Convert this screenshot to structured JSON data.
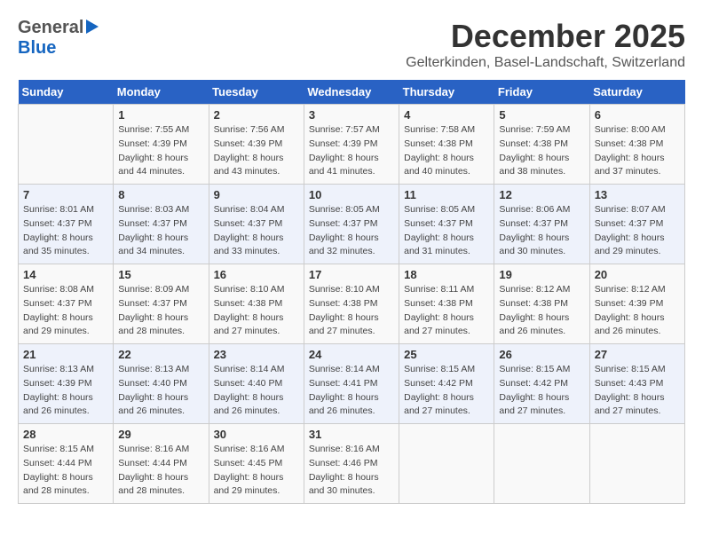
{
  "header": {
    "logo_general": "General",
    "logo_blue": "Blue",
    "month_title": "December 2025",
    "subtitle": "Gelterkinden, Basel-Landschaft, Switzerland"
  },
  "weekdays": [
    "Sunday",
    "Monday",
    "Tuesday",
    "Wednesday",
    "Thursday",
    "Friday",
    "Saturday"
  ],
  "weeks": [
    [
      {
        "day": "",
        "sunrise": "",
        "sunset": "",
        "daylight": ""
      },
      {
        "day": "1",
        "sunrise": "Sunrise: 7:55 AM",
        "sunset": "Sunset: 4:39 PM",
        "daylight": "Daylight: 8 hours and 44 minutes."
      },
      {
        "day": "2",
        "sunrise": "Sunrise: 7:56 AM",
        "sunset": "Sunset: 4:39 PM",
        "daylight": "Daylight: 8 hours and 43 minutes."
      },
      {
        "day": "3",
        "sunrise": "Sunrise: 7:57 AM",
        "sunset": "Sunset: 4:39 PM",
        "daylight": "Daylight: 8 hours and 41 minutes."
      },
      {
        "day": "4",
        "sunrise": "Sunrise: 7:58 AM",
        "sunset": "Sunset: 4:38 PM",
        "daylight": "Daylight: 8 hours and 40 minutes."
      },
      {
        "day": "5",
        "sunrise": "Sunrise: 7:59 AM",
        "sunset": "Sunset: 4:38 PM",
        "daylight": "Daylight: 8 hours and 38 minutes."
      },
      {
        "day": "6",
        "sunrise": "Sunrise: 8:00 AM",
        "sunset": "Sunset: 4:38 PM",
        "daylight": "Daylight: 8 hours and 37 minutes."
      }
    ],
    [
      {
        "day": "7",
        "sunrise": "Sunrise: 8:01 AM",
        "sunset": "Sunset: 4:37 PM",
        "daylight": "Daylight: 8 hours and 35 minutes."
      },
      {
        "day": "8",
        "sunrise": "Sunrise: 8:03 AM",
        "sunset": "Sunset: 4:37 PM",
        "daylight": "Daylight: 8 hours and 34 minutes."
      },
      {
        "day": "9",
        "sunrise": "Sunrise: 8:04 AM",
        "sunset": "Sunset: 4:37 PM",
        "daylight": "Daylight: 8 hours and 33 minutes."
      },
      {
        "day": "10",
        "sunrise": "Sunrise: 8:05 AM",
        "sunset": "Sunset: 4:37 PM",
        "daylight": "Daylight: 8 hours and 32 minutes."
      },
      {
        "day": "11",
        "sunrise": "Sunrise: 8:05 AM",
        "sunset": "Sunset: 4:37 PM",
        "daylight": "Daylight: 8 hours and 31 minutes."
      },
      {
        "day": "12",
        "sunrise": "Sunrise: 8:06 AM",
        "sunset": "Sunset: 4:37 PM",
        "daylight": "Daylight: 8 hours and 30 minutes."
      },
      {
        "day": "13",
        "sunrise": "Sunrise: 8:07 AM",
        "sunset": "Sunset: 4:37 PM",
        "daylight": "Daylight: 8 hours and 29 minutes."
      }
    ],
    [
      {
        "day": "14",
        "sunrise": "Sunrise: 8:08 AM",
        "sunset": "Sunset: 4:37 PM",
        "daylight": "Daylight: 8 hours and 29 minutes."
      },
      {
        "day": "15",
        "sunrise": "Sunrise: 8:09 AM",
        "sunset": "Sunset: 4:37 PM",
        "daylight": "Daylight: 8 hours and 28 minutes."
      },
      {
        "day": "16",
        "sunrise": "Sunrise: 8:10 AM",
        "sunset": "Sunset: 4:38 PM",
        "daylight": "Daylight: 8 hours and 27 minutes."
      },
      {
        "day": "17",
        "sunrise": "Sunrise: 8:10 AM",
        "sunset": "Sunset: 4:38 PM",
        "daylight": "Daylight: 8 hours and 27 minutes."
      },
      {
        "day": "18",
        "sunrise": "Sunrise: 8:11 AM",
        "sunset": "Sunset: 4:38 PM",
        "daylight": "Daylight: 8 hours and 27 minutes."
      },
      {
        "day": "19",
        "sunrise": "Sunrise: 8:12 AM",
        "sunset": "Sunset: 4:38 PM",
        "daylight": "Daylight: 8 hours and 26 minutes."
      },
      {
        "day": "20",
        "sunrise": "Sunrise: 8:12 AM",
        "sunset": "Sunset: 4:39 PM",
        "daylight": "Daylight: 8 hours and 26 minutes."
      }
    ],
    [
      {
        "day": "21",
        "sunrise": "Sunrise: 8:13 AM",
        "sunset": "Sunset: 4:39 PM",
        "daylight": "Daylight: 8 hours and 26 minutes."
      },
      {
        "day": "22",
        "sunrise": "Sunrise: 8:13 AM",
        "sunset": "Sunset: 4:40 PM",
        "daylight": "Daylight: 8 hours and 26 minutes."
      },
      {
        "day": "23",
        "sunrise": "Sunrise: 8:14 AM",
        "sunset": "Sunset: 4:40 PM",
        "daylight": "Daylight: 8 hours and 26 minutes."
      },
      {
        "day": "24",
        "sunrise": "Sunrise: 8:14 AM",
        "sunset": "Sunset: 4:41 PM",
        "daylight": "Daylight: 8 hours and 26 minutes."
      },
      {
        "day": "25",
        "sunrise": "Sunrise: 8:15 AM",
        "sunset": "Sunset: 4:42 PM",
        "daylight": "Daylight: 8 hours and 27 minutes."
      },
      {
        "day": "26",
        "sunrise": "Sunrise: 8:15 AM",
        "sunset": "Sunset: 4:42 PM",
        "daylight": "Daylight: 8 hours and 27 minutes."
      },
      {
        "day": "27",
        "sunrise": "Sunrise: 8:15 AM",
        "sunset": "Sunset: 4:43 PM",
        "daylight": "Daylight: 8 hours and 27 minutes."
      }
    ],
    [
      {
        "day": "28",
        "sunrise": "Sunrise: 8:15 AM",
        "sunset": "Sunset: 4:44 PM",
        "daylight": "Daylight: 8 hours and 28 minutes."
      },
      {
        "day": "29",
        "sunrise": "Sunrise: 8:16 AM",
        "sunset": "Sunset: 4:44 PM",
        "daylight": "Daylight: 8 hours and 28 minutes."
      },
      {
        "day": "30",
        "sunrise": "Sunrise: 8:16 AM",
        "sunset": "Sunset: 4:45 PM",
        "daylight": "Daylight: 8 hours and 29 minutes."
      },
      {
        "day": "31",
        "sunrise": "Sunrise: 8:16 AM",
        "sunset": "Sunset: 4:46 PM",
        "daylight": "Daylight: 8 hours and 30 minutes."
      },
      {
        "day": "",
        "sunrise": "",
        "sunset": "",
        "daylight": ""
      },
      {
        "day": "",
        "sunrise": "",
        "sunset": "",
        "daylight": ""
      },
      {
        "day": "",
        "sunrise": "",
        "sunset": "",
        "daylight": ""
      }
    ]
  ]
}
